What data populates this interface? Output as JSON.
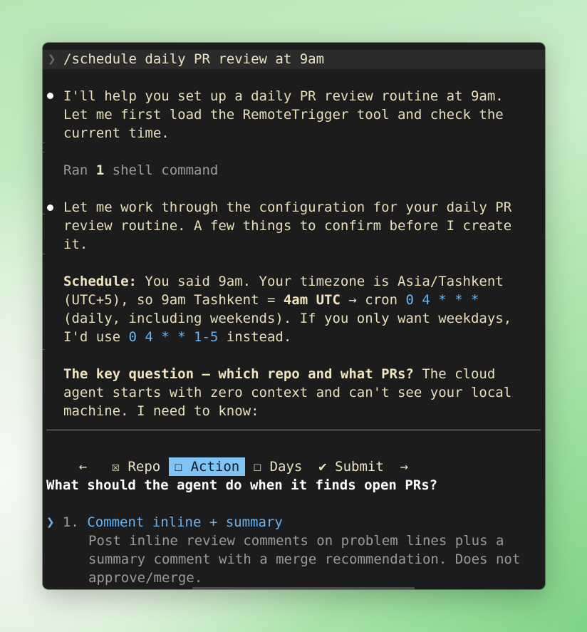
{
  "prompt": {
    "chevron": "❯",
    "command": "/schedule daily PR review at 9am"
  },
  "messages": {
    "m1": {
      "lines": [
        "I'll help you set up a daily PR review routine at 9am.",
        "Let me first load the RemoteTrigger tool and check the",
        "current time."
      ]
    },
    "ran": {
      "prefix": "Ran ",
      "count": "1",
      "suffix": " shell command"
    },
    "m2": {
      "lines": [
        "Let me work through the configuration for your daily PR",
        "review routine. A few things to confirm before I create",
        "it."
      ]
    },
    "schedule": {
      "label": "Schedule:",
      "l1_rest": " You said 9am. Your timezone is Asia/Tashkent",
      "l2_a": "(UTC+5), so 9am Tashkent = ",
      "l2_bold": "4am UTC",
      "l2_b": " → cron ",
      "l2_cron": "0 4 * * *",
      "l3": "(daily, including weekends). If you only want weekdays,",
      "l4_a": "I'd use ",
      "l4_cron": "0 4 * * 1-5",
      "l4_b": " instead."
    },
    "key": {
      "bold": "The key question — which repo and what PRs?",
      "l1_rest": " The cloud",
      "l2": "agent starts with zero context and can't see your local",
      "l3": "machine. I need to know:"
    }
  },
  "tabs": {
    "left_arrow": "←",
    "repo_box": "☒",
    "repo": "Repo",
    "action_box": "☐",
    "action": "Action",
    "days_box": "☐",
    "days": "Days",
    "submit_check": "✔",
    "submit": "Submit",
    "right_arrow": "→"
  },
  "question": "What should the agent do when it finds open PRs?",
  "options": [
    {
      "pointer": "❯",
      "number": "1.",
      "title": "Comment inline + summary",
      "desc": [
        "Post inline review comments on problem lines plus a",
        "summary comment with a merge recommendation. Does not",
        "approve/merge."
      ]
    }
  ],
  "colors": {
    "accent": "#67b5f2",
    "active_tab_bg": "#7fc4f5",
    "text": "#e9dfb9",
    "background": "#1c1c1c"
  }
}
